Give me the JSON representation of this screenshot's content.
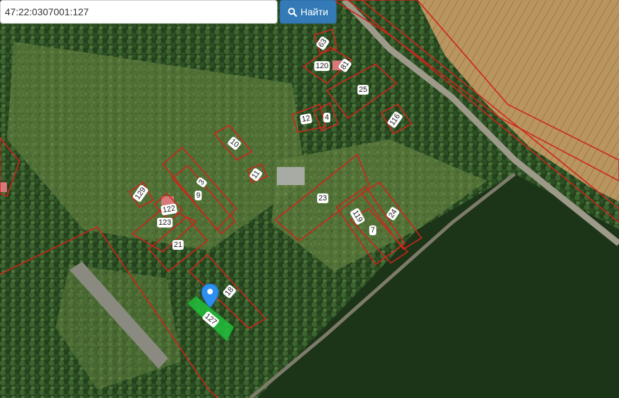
{
  "search": {
    "value": "47:22:0307001:127",
    "button_label": "Найти",
    "button_icon": "search-icon",
    "button_color": "#337ab7"
  },
  "map": {
    "boundary_color": "#d0241b",
    "selected_plot_color": "#22c03a",
    "marker_color": "#2d8ff0",
    "plots": [
      "63",
      "120",
      "81",
      "25",
      "12",
      "4",
      "116",
      "10",
      "11",
      "3",
      "9",
      "129",
      "122",
      "123",
      "21",
      "23",
      "119",
      "7",
      "24",
      "18",
      "127"
    ],
    "selected_plot": "127"
  }
}
